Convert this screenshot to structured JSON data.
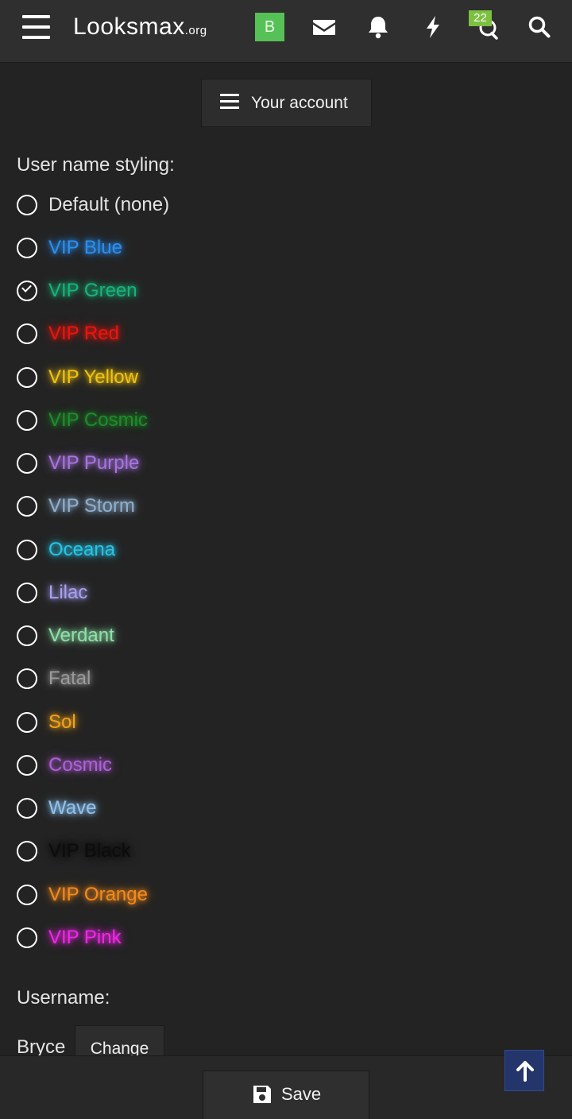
{
  "header": {
    "logo_main": "Looksmax",
    "logo_suffix": ".org",
    "avatar_letter": "B",
    "chat_badge": "22",
    "icons": [
      "menu-icon",
      "mail-icon",
      "bell-icon",
      "lightning-icon",
      "chat-icon",
      "search-icon"
    ]
  },
  "account_menu": {
    "label": "Your account"
  },
  "styling": {
    "label": "User name styling:",
    "selected": "VIP Green",
    "options": [
      {
        "name": "Default (none)",
        "color": "#e4e4e4"
      },
      {
        "name": "VIP Blue",
        "color": "#2b8ff0"
      },
      {
        "name": "VIP Green",
        "color": "#19b27a"
      },
      {
        "name": "VIP Red",
        "color": "#e8160f"
      },
      {
        "name": "VIP Yellow",
        "color": "#f1c412"
      },
      {
        "name": "VIP Cosmic",
        "color": "#1f8c2a"
      },
      {
        "name": "VIP Purple",
        "color": "#a874e0"
      },
      {
        "name": "VIP Storm",
        "color": "#8fb0cf"
      },
      {
        "name": "Oceana",
        "color": "#28c4e5"
      },
      {
        "name": "Lilac",
        "color": "#a8a0f0"
      },
      {
        "name": "Verdant",
        "color": "#8fe0a8"
      },
      {
        "name": "Fatal",
        "color": "#9a9a9a"
      },
      {
        "name": "Sol",
        "color": "#f2a41a"
      },
      {
        "name": "Cosmic",
        "color": "#b060d8"
      },
      {
        "name": "Wave",
        "color": "#8ec4f0"
      },
      {
        "name": "VIP Black",
        "color": "#0c0c0c"
      },
      {
        "name": "VIP Orange",
        "color": "#f28a1e"
      },
      {
        "name": "VIP Pink",
        "color": "#f026e8"
      }
    ]
  },
  "username": {
    "label": "Username:",
    "value": "Bryce",
    "change_label": "Change"
  },
  "footer": {
    "save_label": "Save"
  }
}
